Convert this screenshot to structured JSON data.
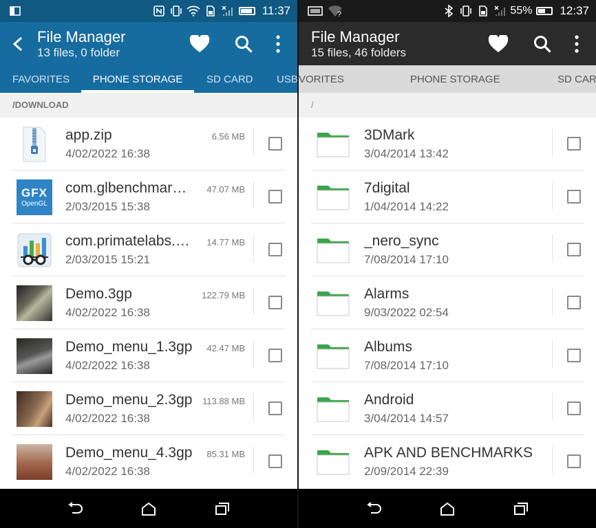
{
  "left": {
    "status": {
      "time": "11:37"
    },
    "title": "File Manager",
    "subtitle": "13 files, 0 folder",
    "tabs": [
      "FAVORITES",
      "PHONE STORAGE",
      "SD CARD",
      "USB"
    ],
    "active_tab": "PHONE STORAGE",
    "path": "/DOWNLOAD",
    "files": [
      {
        "name": "app.zip",
        "date": "4/02/2022 16:38",
        "size": "6.56 MB",
        "thumb": "zip-icon"
      },
      {
        "name": "com.glbenchmark....",
        "date": "2/03/2015 15:38",
        "size": "47.07 MB",
        "thumb": "gfx-opengl-icon",
        "thumb_text1": "GFX",
        "thumb_text2": "OpenGL"
      },
      {
        "name": "com.primatelabs.g...",
        "date": "2/03/2015 15:21",
        "size": "14.77 MB",
        "thumb": "geekbench-icon"
      },
      {
        "name": "Demo.3gp",
        "date": "4/02/2022 16:38",
        "size": "122.79 MB",
        "thumb": "video-thumbnail"
      },
      {
        "name": "Demo_menu_1.3gp",
        "date": "4/02/2022 16:38",
        "size": "42.47 MB",
        "thumb": "video-thumbnail"
      },
      {
        "name": "Demo_menu_2.3gp",
        "date": "4/02/2022 16:38",
        "size": "113.88 MB",
        "thumb": "video-thumbnail"
      },
      {
        "name": "Demo_menu_4.3gp",
        "date": "4/02/2022 16:38",
        "size": "85.31 MB",
        "thumb": "video-thumbnail"
      }
    ]
  },
  "right": {
    "status": {
      "time": "12:37",
      "battery": "55%",
      "battery_level": 0.55
    },
    "title": "File Manager",
    "subtitle": "15 files, 46 folders",
    "tabs": [
      "VORITES",
      "PHONE STORAGE",
      "SD CARI"
    ],
    "active_tab": "PHONE STORAGE",
    "path": "/",
    "folders": [
      {
        "name": "3DMark",
        "date": "3/04/2014 13:42"
      },
      {
        "name": "7digital",
        "date": "1/04/2014 14:22"
      },
      {
        "name": "_nero_sync",
        "date": "7/08/2014 17:10"
      },
      {
        "name": "Alarms",
        "date": "9/03/2022 02:54"
      },
      {
        "name": "Albums",
        "date": "7/08/2014 17:10"
      },
      {
        "name": "Android",
        "date": "3/04/2014 14:57"
      },
      {
        "name": "APK AND BENCHMARKS",
        "date": "2/09/2014 22:39"
      }
    ]
  },
  "colors": {
    "accent_blue": "#176c9f",
    "folder_green": "#3aa64a"
  }
}
